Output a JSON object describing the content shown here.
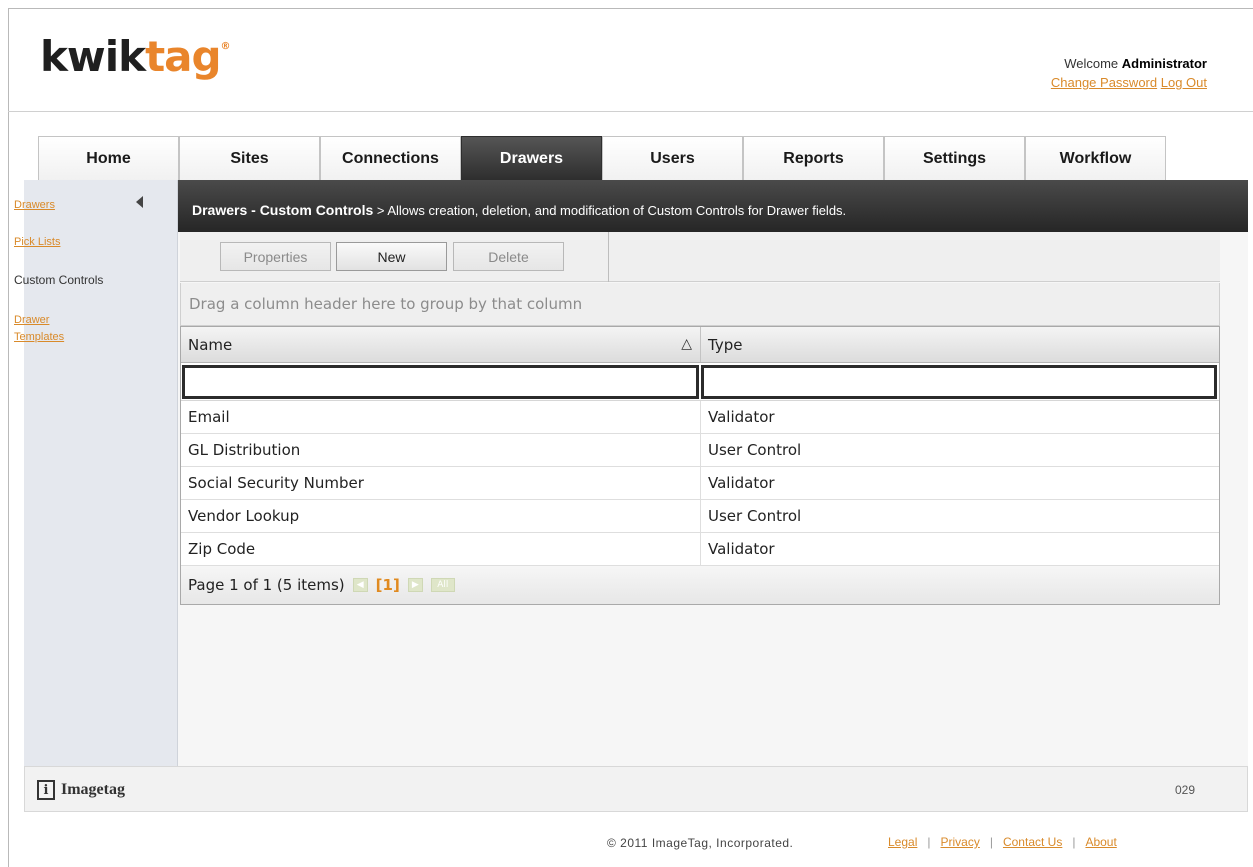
{
  "header": {
    "logo": {
      "kwik": "kwik",
      "tag": "tag",
      "reg": "®"
    },
    "welcome_prefix": "Welcome",
    "user": "Administrator",
    "change_password": "Change Password",
    "logout": "Log Out"
  },
  "tabs": [
    {
      "label": "Home"
    },
    {
      "label": "Sites"
    },
    {
      "label": "Connections"
    },
    {
      "label": "Drawers",
      "active": true
    },
    {
      "label": "Users"
    },
    {
      "label": "Reports"
    },
    {
      "label": "Settings"
    },
    {
      "label": "Workflow"
    }
  ],
  "sidebar": {
    "items": [
      {
        "label": "Drawers"
      },
      {
        "label": "Pick Lists"
      },
      {
        "label": "Custom Controls"
      },
      {
        "label": "Drawer"
      },
      {
        "label": "Templates"
      }
    ]
  },
  "content": {
    "title": "Drawers - Custom Controls",
    "description": " > Allows creation, deletion, and modification of Custom Controls for Drawer fields."
  },
  "toolbar": {
    "properties": "Properties",
    "new": "New",
    "delete": "Delete"
  },
  "grid": {
    "group_hint": "Drag a column header here to group by that column",
    "columns": [
      "Name",
      "Type"
    ],
    "sort_symbol": "△",
    "rows": [
      [
        "Email",
        "Validator"
      ],
      [
        "GL Distribution",
        "User Control"
      ],
      [
        "Social Security Number",
        "Validator"
      ],
      [
        "Vendor Lookup",
        "User Control"
      ],
      [
        "Zip Code",
        "Validator"
      ]
    ],
    "pager": {
      "text": "Page 1 of 1 (5 items)",
      "current": "[1]",
      "all": "All"
    }
  },
  "footer": {
    "brand": "Imagetag",
    "brand_icon": "i",
    "code": "029",
    "copyright": "© 2011 ImageTag, Incorporated.",
    "links": [
      "Legal",
      "Privacy",
      "Contact Us",
      "About"
    ]
  },
  "colors": {
    "accent": "#e9852b",
    "link": "#d98a2a",
    "active_tab": "#333333"
  }
}
